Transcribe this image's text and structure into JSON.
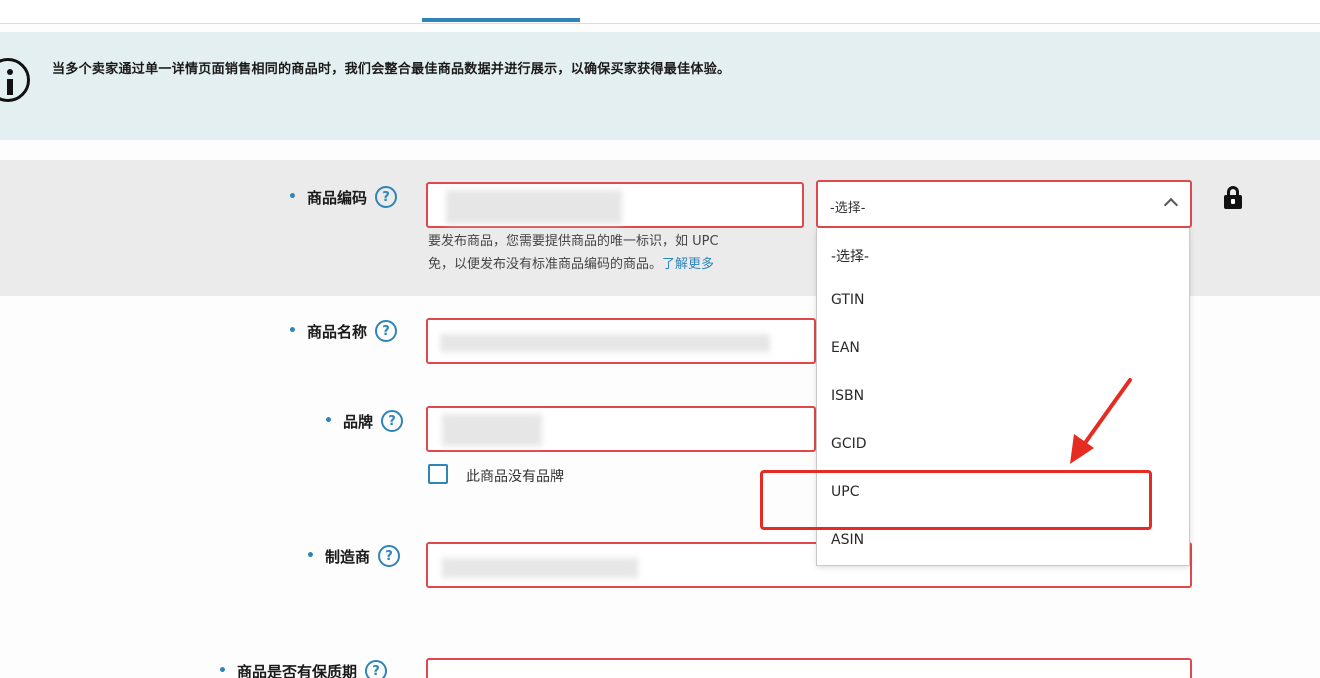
{
  "info": {
    "message": "当多个卖家通过单一详情页面销售相同的商品时，我们会整合最佳商品数据并进行展示，以确保买家获得最佳体验。"
  },
  "fields": {
    "product_id": {
      "label": "商品编码",
      "required_mark": "•",
      "help": "?"
    },
    "product_name": {
      "label": "商品名称",
      "required_mark": "•",
      "help": "?"
    },
    "brand": {
      "label": "品牌",
      "required_mark": "•",
      "help": "?"
    },
    "manufacturer": {
      "label": "制造商",
      "required_mark": "•",
      "help": "?"
    },
    "warranty": {
      "label": "商品是否有保质期",
      "required_mark": "•",
      "help": "?"
    }
  },
  "helper": {
    "line1": "要发布商品，您需要提供商品的唯一标识，如 UPC",
    "line2": "免，以便发布没有标准商品编码的商品。",
    "link": "了解更多"
  },
  "select": {
    "value": "-选择-",
    "options": [
      "-选择-",
      "GTIN",
      "EAN",
      "ISBN",
      "GCID",
      "UPC",
      "ASIN"
    ],
    "highlighted": "UPC"
  },
  "brand_checkbox": {
    "label": "此商品没有品牌",
    "checked": false
  },
  "colors": {
    "accent": "#2f85b8",
    "error_border": "#e0494b",
    "annotation_red": "#e52b22",
    "banner_bg": "#e4eff2"
  }
}
